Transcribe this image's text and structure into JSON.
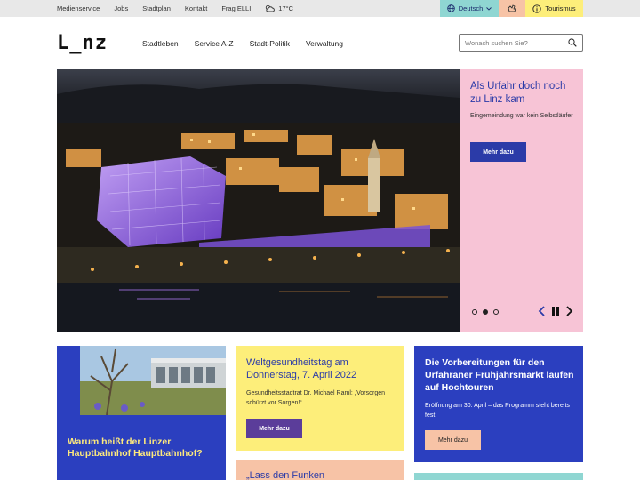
{
  "topbar": {
    "links": [
      "Medienservice",
      "Jobs",
      "Stadtplan",
      "Kontakt",
      "Frag ELLI"
    ],
    "weather": "17°C",
    "language": "Deutsch",
    "tourism": "Tourismus"
  },
  "header": {
    "logo": "L_nz",
    "nav": [
      "Stadtleben",
      "Service A-Z",
      "Stadt-Politik",
      "Verwaltung"
    ],
    "search_placeholder": "Wonach suchen Sie?"
  },
  "hero": {
    "title": "Als Urfahr doch noch zu Linz kam",
    "subtitle": "Eingemeindung war kein Selbstläufer",
    "button": "Mehr dazu"
  },
  "cards": {
    "card1": {
      "title": "Warum heißt der Linzer Hauptbahnhof Hauptbahnhof?"
    },
    "card2": {
      "title": "Weltgesundheitstag am Donnerstag, 7. April 2022",
      "text": "Gesundheitsstadtrat Dr. Michael Raml: „Vorsorgen schützt vor Sorgen!“",
      "button": "Mehr dazu"
    },
    "card3": {
      "title": "Die Vorbereitungen für den Urfahraner Frühjahrsmarkt laufen auf Hochtouren",
      "text": "Eröffnung am 30. April – das Programm steht bereits fest",
      "button": "Mehr dazu"
    },
    "card4": {
      "title": "„Lass den Funken"
    }
  },
  "colors": {
    "accent_blue": "#2b3ba8",
    "pink": "#f7c4d6",
    "yellow": "#fdee7a",
    "peach": "#f7c3a6",
    "teal": "#8fd6d2"
  }
}
